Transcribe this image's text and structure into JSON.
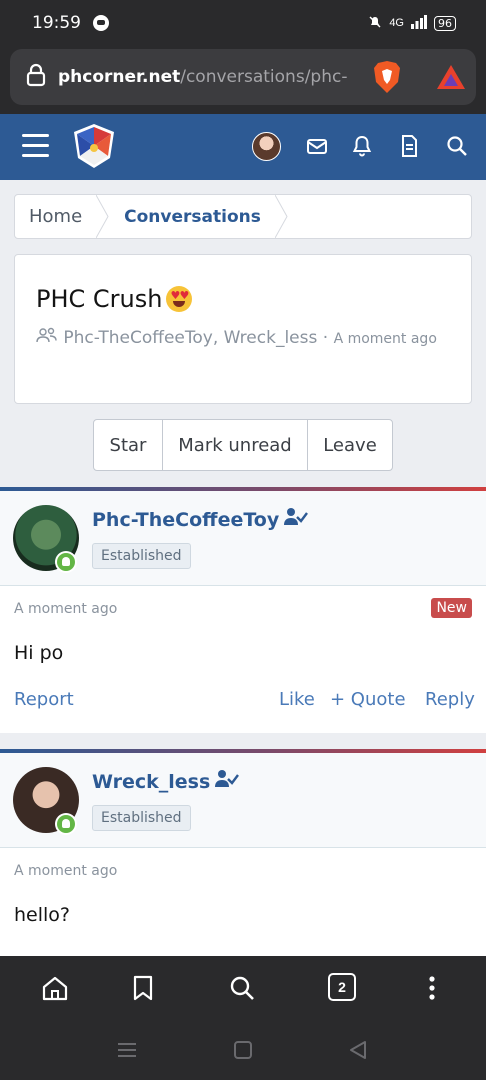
{
  "status": {
    "time": "19:59",
    "network": "4G",
    "battery": "96"
  },
  "browser": {
    "url_domain": "phcorner.net",
    "url_path": "/conversations/phc-cr"
  },
  "breadcrumb": {
    "home": "Home",
    "current": "Conversations"
  },
  "conversation": {
    "title": "PHC Crush",
    "participants": "Phc-TheCoffeeToy, Wreck_less",
    "separator": "·",
    "time": "A moment ago"
  },
  "actions": {
    "star": "Star",
    "mark_unread": "Mark unread",
    "leave": "Leave"
  },
  "messages": [
    {
      "author": "Phc-TheCoffeeToy",
      "badge": "Established",
      "time": "A moment ago",
      "new_label": "New",
      "body": "Hi po",
      "report": "Report",
      "like": "Like",
      "quote": "+ Quote",
      "reply": "Reply"
    },
    {
      "author": "Wreck_less",
      "badge": "Established",
      "time": "A moment ago",
      "body": "hello?"
    }
  ],
  "tabs": {
    "count": "2"
  },
  "colors": {
    "header": "#2d5a94",
    "link": "#4a7ab8",
    "new_badge": "#c84c4c",
    "online": "#63b646"
  }
}
